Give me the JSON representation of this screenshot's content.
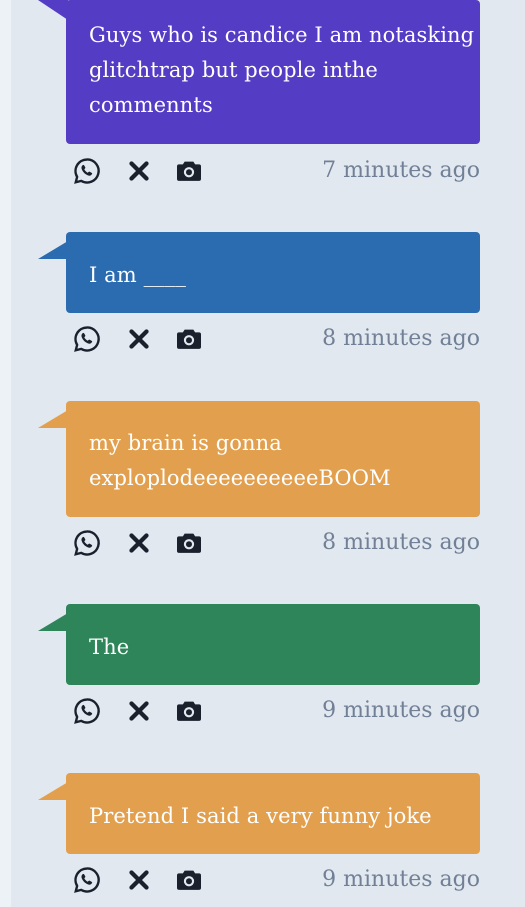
{
  "colors": {
    "background": "#e2e8f0",
    "timestamp": "#718096",
    "icon": "#1a202c"
  },
  "icons": {
    "whatsapp": "whatsapp-icon",
    "close": "x-icon",
    "camera": "camera-icon"
  },
  "posts": [
    {
      "text": "Guys who is candice I am notasking glitchtrap but people inthe commennts",
      "time": "7 minutes ago",
      "color": "#553cc4"
    },
    {
      "text": "I am ____",
      "time": "8 minutes ago",
      "color": "#2b6cb0"
    },
    {
      "text": "my brain is gonna exploplodeeeeeeeeeeBOOM",
      "time": "8 minutes ago",
      "color": "#e2a04e"
    },
    {
      "text": "The",
      "time": "9 minutes ago",
      "color": "#2f855a"
    },
    {
      "text": "Pretend I said a very funny joke",
      "time": "9 minutes ago",
      "color": "#e2a04e"
    }
  ]
}
